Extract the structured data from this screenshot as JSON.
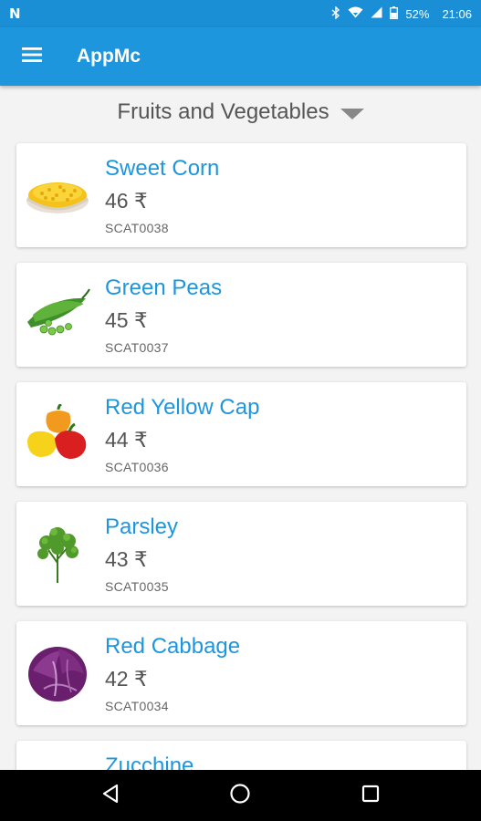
{
  "status_bar": {
    "battery": "52%",
    "time": "21:06"
  },
  "app_bar": {
    "title": "AppMc"
  },
  "category_spinner": {
    "selected": "Fruits and Vegetables"
  },
  "products": [
    {
      "name": "Sweet Corn",
      "price": "46 ₹",
      "code": "SCAT0038",
      "icon": "sweet-corn-image"
    },
    {
      "name": "Green Peas",
      "price": "45 ₹",
      "code": "SCAT0037",
      "icon": "green-peas-image"
    },
    {
      "name": "Red Yellow Cap",
      "price": "44 ₹",
      "code": "SCAT0036",
      "icon": "bell-pepper-image"
    },
    {
      "name": "Parsley",
      "price": "43 ₹",
      "code": "SCAT0035",
      "icon": "parsley-image"
    },
    {
      "name": "Red Cabbage",
      "price": "42 ₹",
      "code": "SCAT0034",
      "icon": "red-cabbage-image"
    },
    {
      "name": "Zucchine",
      "price": "",
      "code": "",
      "icon": "zucchini-image"
    }
  ],
  "colors": {
    "primary": "#1e96dd",
    "status_bar": "#1a8fd6",
    "background": "#f3f3f3"
  }
}
